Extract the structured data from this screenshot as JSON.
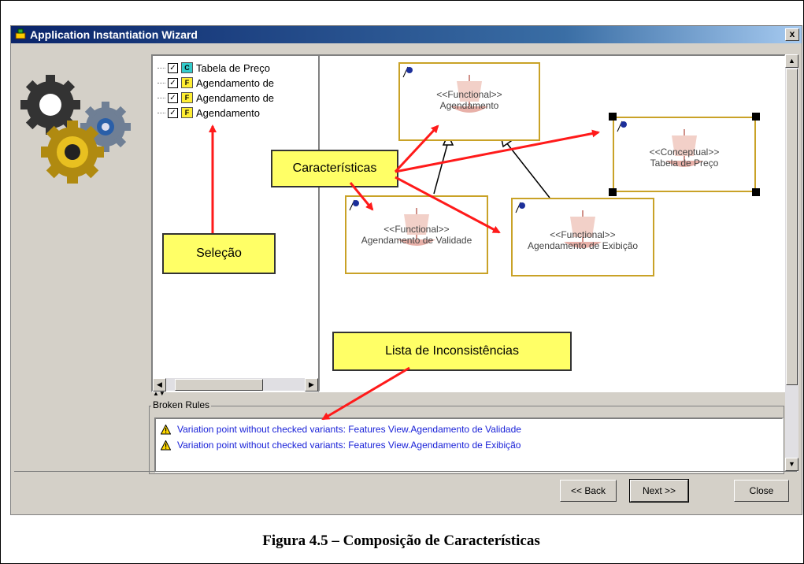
{
  "window": {
    "title": "Application Instantiation Wizard",
    "close_label": "x"
  },
  "tree": {
    "items": [
      {
        "label": "Tabela de Preço",
        "checked": "✓",
        "icon": "c-icon",
        "icon_text": "C",
        "icon_color": "#33cccc"
      },
      {
        "label": "Agendamento de",
        "checked": "✓",
        "icon": "f-icon",
        "icon_text": "F",
        "icon_color": "#ffee33"
      },
      {
        "label": "Agendamento de",
        "checked": "✓",
        "icon": "f-icon",
        "icon_text": "F",
        "icon_color": "#ffee33"
      },
      {
        "label": "Agendamento",
        "checked": "✓",
        "icon": "f-icon",
        "icon_text": "F",
        "icon_color": "#ffee33"
      }
    ]
  },
  "diagram": {
    "boxes": [
      {
        "stereotype": "<<Functional>>",
        "name": "Agendamento"
      },
      {
        "stereotype": "<<Conceptual>>",
        "name": "Tabela de Preço"
      },
      {
        "stereotype": "<<Functional>>",
        "name": "Agendamento de Validade"
      },
      {
        "stereotype": "<<Functional>>",
        "name": "Agendamento de Exibição"
      }
    ],
    "box_border_color": "#c9a227"
  },
  "callouts": {
    "caracteristicas": "Características",
    "selecao": "Seleção",
    "lista": "Lista de Inconsistências"
  },
  "broken_rules": {
    "title": "Broken Rules",
    "items": [
      "Variation point without checked variants: Features View.Agendamento de Validade",
      "Variation point without checked variants: Features View.Agendamento de Exibição"
    ],
    "text_color": "#1a22d8"
  },
  "buttons": {
    "back": "<< Back",
    "next": "Next >>",
    "close": "Close"
  },
  "caption": "Figura 4.5 – Composição de Características",
  "colors": {
    "arrow": "#ff1a1a",
    "callout_bg": "#ffff66",
    "titlebar": "#0a246a"
  }
}
